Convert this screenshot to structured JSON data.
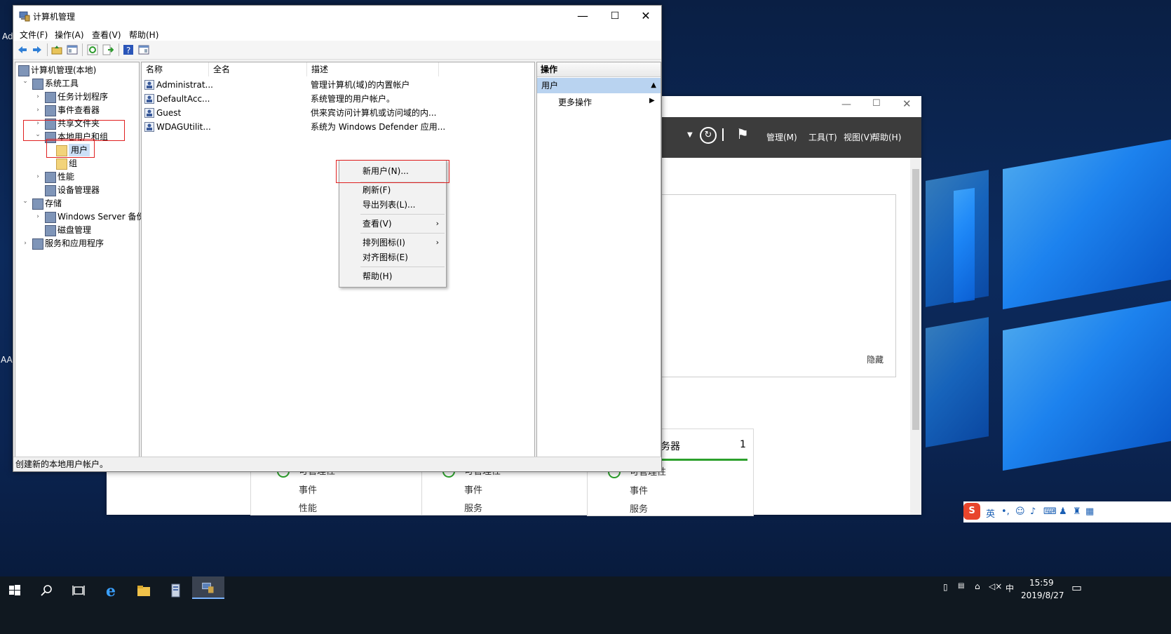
{
  "desktop": {
    "left_texts": [
      "Ad",
      "AA("
    ]
  },
  "server_manager": {
    "menu": [
      "管理(M)",
      "工具(T)",
      "视图(V)",
      "帮助(H)"
    ],
    "hide_label": "隐藏",
    "tile_title": "务器",
    "tile_count": "1",
    "tile_lines": [
      [
        "可管理性",
        "事件",
        "性能"
      ],
      [
        "可管理性",
        "事件",
        "服务"
      ],
      [
        "可管理性",
        "事件",
        "服务"
      ]
    ]
  },
  "mmc": {
    "title": "计算机管理",
    "menu": [
      "文件(F)",
      "操作(A)",
      "查看(V)",
      "帮助(H)"
    ],
    "tree": [
      {
        "label": "计算机管理(本地)",
        "level": 0,
        "arrow": ""
      },
      {
        "label": "系统工具",
        "level": 1,
        "arrow": "v"
      },
      {
        "label": "任务计划程序",
        "level": 2,
        "arrow": ">"
      },
      {
        "label": "事件查看器",
        "level": 2,
        "arrow": ">"
      },
      {
        "label": "共享文件夹",
        "level": 2,
        "arrow": ">"
      },
      {
        "label": "本地用户和组",
        "level": 2,
        "arrow": "v"
      },
      {
        "label": "用户",
        "level": 3,
        "arrow": ""
      },
      {
        "label": "组",
        "level": 3,
        "arrow": ""
      },
      {
        "label": "性能",
        "level": 2,
        "arrow": ">"
      },
      {
        "label": "设备管理器",
        "level": 2,
        "arrow": ""
      },
      {
        "label": "存储",
        "level": 1,
        "arrow": "v"
      },
      {
        "label": "Windows Server 备份",
        "level": 2,
        "arrow": ">"
      },
      {
        "label": "磁盘管理",
        "level": 2,
        "arrow": ""
      },
      {
        "label": "服务和应用程序",
        "level": 1,
        "arrow": ">"
      }
    ],
    "columns": [
      "名称",
      "全名",
      "描述"
    ],
    "rows": [
      {
        "name": "Administrat...",
        "full": "",
        "desc": "管理计算机(域)的内置帐户"
      },
      {
        "name": "DefaultAcc...",
        "full": "",
        "desc": "系统管理的用户帐户。"
      },
      {
        "name": "Guest",
        "full": "",
        "desc": "供来宾访问计算机或访问域的内..."
      },
      {
        "name": "WDAGUtilit...",
        "full": "",
        "desc": "系统为 Windows Defender 应用..."
      }
    ],
    "actions": {
      "header": "操作",
      "selected": "用户",
      "more": "更多操作"
    },
    "status": "创建新的本地用户帐户。"
  },
  "context_menu": {
    "items": [
      "新用户(N)...",
      "刷新(F)",
      "导出列表(L)...",
      "查看(V)",
      "排列图标(I)",
      "对齐图标(E)",
      "帮助(H)"
    ]
  },
  "taskbar": {
    "time": "15:59",
    "date": "2019/8/27",
    "ime_lang": "中",
    "ime_mode": "英"
  },
  "colors": {
    "accent_blue": "#1e8cff",
    "selection": "#b9d3f0",
    "highlight_red": "#e02020",
    "status_green": "#2ca02c"
  }
}
